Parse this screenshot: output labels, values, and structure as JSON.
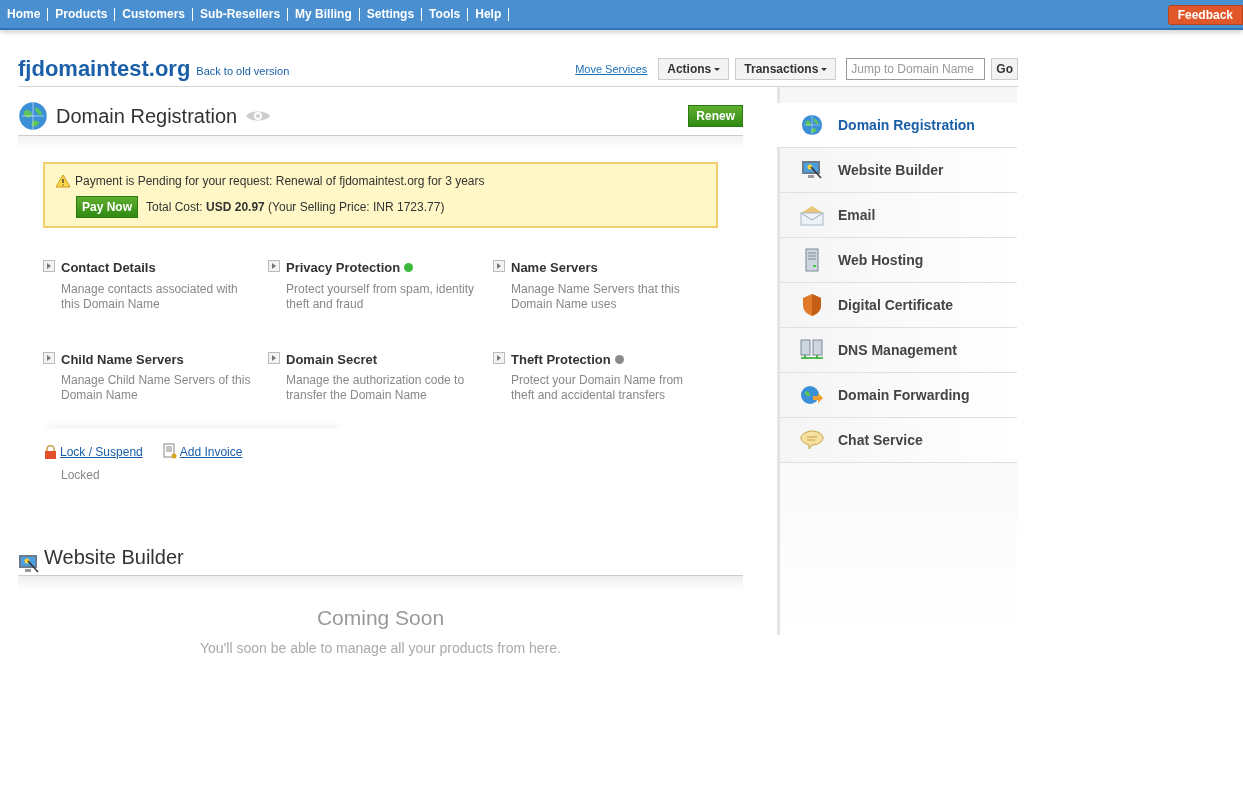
{
  "nav": {
    "items": [
      "Home",
      "Products",
      "Customers",
      "Sub-Resellers",
      "My Billing",
      "Settings",
      "Tools",
      "Help"
    ],
    "feedback": "Feedback"
  },
  "header": {
    "domain": "fjdomaintest.org",
    "back_link": "Back to old version",
    "move_link": "Move Services",
    "actions": "Actions",
    "transactions": "Transactions",
    "jump_placeholder": "Jump to Domain Name",
    "go": "Go"
  },
  "section": {
    "title": "Domain Registration",
    "renew": "Renew",
    "alert": {
      "message": "Payment is Pending for your request: Renewal of fjdomaintest.org for 3 years",
      "pay_now": "Pay Now",
      "cost": "Total Cost:  **USD 20.97** (Your Selling Price:  INR 1723.77)"
    },
    "options": [
      {
        "title": "Contact Details",
        "description": "Manage contacts associated with this Domain Name"
      },
      {
        "title": "Privacy Protection",
        "description": "Protect yourself from spam, identity theft and fraud",
        "color": "#3cb83c"
      },
      {
        "title": "Name Servers",
        "description": "Manage Name Servers that this Domain Name uses"
      },
      {
        "title": "Child Name Servers",
        "description": "Manage Child Name Servers of this Domain Name"
      },
      {
        "title": "Domain Secret",
        "description": "Manage the authorization code to transfer the Domain Name"
      },
      {
        "title": "Theft Protection",
        "description": "Protect your Domain Name from theft and accidental transfers",
        "color": "#8a8a8a"
      }
    ],
    "lock_link": "Lock / Suspend",
    "lock_state": "Locked",
    "invoice_link": "Add Invoice"
  },
  "builder": {
    "title": "Website Builder",
    "heading": "Coming Soon",
    "text": "You'll soon be able to manage all your products from here."
  },
  "sidebar": {
    "items": [
      {
        "label": "Domain Registration",
        "kind": "globe",
        "selected": true
      },
      {
        "label": "Website Builder",
        "kind": "monitor",
        "selected": false
      },
      {
        "label": "Email",
        "kind": "envelope",
        "selected": false
      },
      {
        "label": "Web Hosting",
        "kind": "server",
        "selected": false
      },
      {
        "label": "Digital Certificate",
        "kind": "shield",
        "selected": false
      },
      {
        "label": "DNS Management",
        "kind": "servers",
        "selected": false
      },
      {
        "label": "Domain Forwarding",
        "kind": "forward",
        "selected": false
      },
      {
        "label": "Chat Service",
        "kind": "chat",
        "selected": false
      }
    ]
  }
}
